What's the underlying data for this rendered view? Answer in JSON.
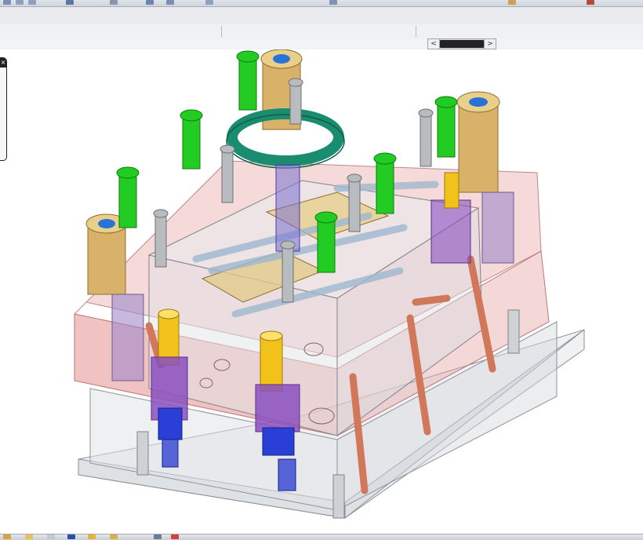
{
  "window": {
    "title": ""
  },
  "toolbar": {
    "icons": [
      "save-icon",
      "undo-icon",
      "redo-icon",
      "select-icon",
      "zoom-icon",
      "rotate-icon",
      "pan-icon",
      "view-icon",
      "render-icon",
      "measure-icon",
      "settings-icon"
    ]
  },
  "scrollbar": {
    "left_arrow": "<",
    "right_arrow": ">"
  },
  "side_panel": {
    "close_label": "×"
  },
  "taskbar": {
    "icons": [
      "start-icon",
      "folder-icon",
      "window-icon",
      "app-icon-1",
      "app-icon-2",
      "app-icon-3",
      "app-icon-4",
      "app-icon-5"
    ]
  },
  "colors": {
    "plate_red": "#e8a0a0",
    "plate_glass": "#d8dde3",
    "bolt_green": "#22cc22",
    "ring_teal": "#1a8c6f",
    "bushing_tan": "#d9b26a",
    "spring_purple": "#8a4fc0",
    "spring_blue": "#2a3fd6",
    "pin_copper": "#d2785a",
    "pin_yellow": "#f2c21a"
  }
}
